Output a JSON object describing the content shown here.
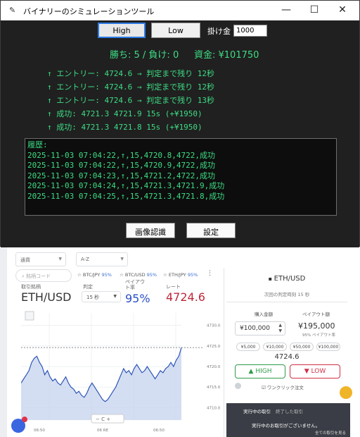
{
  "window": {
    "title": "バイナリーのシミュレーションツール",
    "controls": {
      "minimize": "—",
      "maximize": "☐",
      "close": "✕"
    }
  },
  "controls": {
    "high_label": "High",
    "low_label": "Low",
    "bet_label": "掛け金",
    "bet_value": "1000"
  },
  "stats": {
    "score": "勝ち: 5 / 負け: 0",
    "funds": "資金: ¥101750"
  },
  "log": [
    "↑ エントリー: 4724.6 → 判定まで残り 12秒",
    "↑ エントリー: 4724.6 → 判定まで残り 12秒",
    "↑ エントリー: 4724.6 → 判定まで残り 13秒",
    "↑ 成功: 4721.3 4721.9 15s (+¥1950)",
    "↑ 成功: 4721.3 4721.8 15s (+¥1950)"
  ],
  "history": {
    "header": "履歴:",
    "rows": [
      "2025-11-03 07:04:22,↑,15,4720.8,4722,成功",
      "2025-11-03 07:04:22,↑,15,4720.9,4722,成功",
      "2025-11-03 07:04:23,↑,15,4721.2,4722,成功",
      "2025-11-03 07:04:24,↑,15,4721.3,4721.9,成功",
      "2025-11-03 07:04:25,↑,15,4721.3,4721.8,成功"
    ]
  },
  "bottom_buttons": {
    "image_recognition": "画像認識",
    "settings": "設定"
  },
  "trading_page": {
    "filter1": "通貨",
    "filter2": "A-Z",
    "search_placeholder": "銘柄コード",
    "favorites": [
      {
        "name": "BTC/JPY",
        "pct": "95%"
      },
      {
        "name": "BTC/USD",
        "pct": "95%"
      },
      {
        "name": "ETH/JPY",
        "pct": "95%"
      }
    ],
    "asset_label": "取引銘柄",
    "asset_name": "ETH/USD",
    "judge_label": "判定",
    "judge_value": "15 秒",
    "payout_label": "ペイアウト率",
    "payout_value": "95%",
    "rate_label": "レート",
    "rate_value": "4724.6",
    "panel_asset": "ETH/USD",
    "panel_sub": "次回の判定時刻 15 秒",
    "amount_label": "購入金額",
    "payout_amount_label": "ペイアウト額",
    "amount_value": "¥100,000",
    "payout_amount": "¥195,000",
    "payout_sub": "95% ペイアウト率",
    "chips": [
      "¥5,000",
      "¥10,000",
      "¥50,000",
      "¥100,000"
    ],
    "current_price": "4724.6",
    "high_button": "HIGH",
    "low_button": "LOW",
    "oneclick": "ワンクリック注文",
    "orders_title": "実行中の取引",
    "orders_tab2": "終了した取引",
    "orders_empty": "実行中のお取引がございません。",
    "orders_link": "全ての取引を見る",
    "y_ticks": [
      "4730.0",
      "4725.0",
      "4720.0",
      "4715.0",
      "4710.0"
    ],
    "x_ticks": [
      "06:50",
      "06 RE",
      "06:50"
    ]
  },
  "colors": {
    "accent_green": "#3ddc84",
    "window_bg": "#202020",
    "high_green": "#2f9b4a",
    "low_red": "#d03045",
    "rate_red": "#c0263b",
    "payout_blue": "#2b4fc7"
  },
  "chart_data": {
    "type": "line",
    "ylim": [
      4707,
      4733
    ],
    "reference_line": 4724.6,
    "y_ticks": [
      4730.0,
      4725.0,
      4720.0,
      4715.0,
      4710.0
    ],
    "values": [
      4716,
      4717,
      4718,
      4719,
      4721,
      4722,
      4722.5,
      4721,
      4720,
      4718,
      4719,
      4717.5,
      4716.5,
      4717,
      4716,
      4715.5,
      4716.5,
      4717.5,
      4716,
      4715,
      4714.5,
      4713.5,
      4714,
      4713,
      4712.5,
      4713.5,
      4715,
      4716,
      4715,
      4714,
      4713,
      4712,
      4711.5,
      4712,
      4713,
      4714,
      4715,
      4716.5,
      4718,
      4719.5,
      4718.5,
      4719,
      4718,
      4719.5,
      4720.5,
      4719.5,
      4718.5,
      4719,
      4720,
      4719,
      4718,
      4717,
      4718,
      4719,
      4718.5,
      4719.5,
      4720,
      4721,
      4720,
      4721.5,
      4722.5,
      4724.6
    ]
  }
}
